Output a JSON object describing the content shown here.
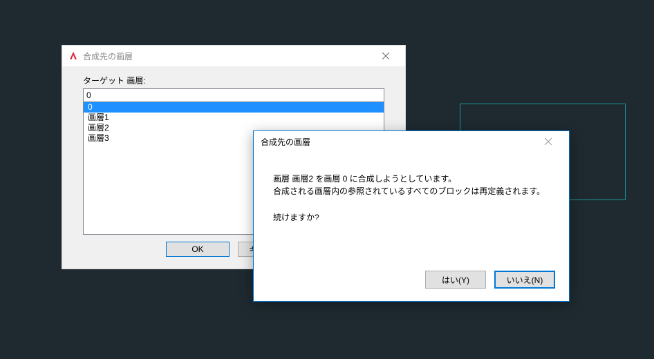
{
  "background": {
    "accent_rect_color": "#1a9b9f"
  },
  "dialog1": {
    "title": "合成先の画層",
    "target_label": "ターゲット 画層:",
    "input_value": "0",
    "list_items": [
      "0",
      "画層1",
      "画層2",
      "画層3"
    ],
    "selected_index": 0,
    "buttons": {
      "ok": "OK",
      "cancel": "キャンセル"
    }
  },
  "dialog2": {
    "title": "合成先の画層",
    "message_line1": "画層 画層2 を画層 0 に合成しようとしています。",
    "message_line2": "合成される画層内の参照されているすべてのブロックは再定義されます。",
    "message_prompt": "続けますか?",
    "buttons": {
      "yes": "はい(Y)",
      "no": "いいえ(N)"
    }
  }
}
